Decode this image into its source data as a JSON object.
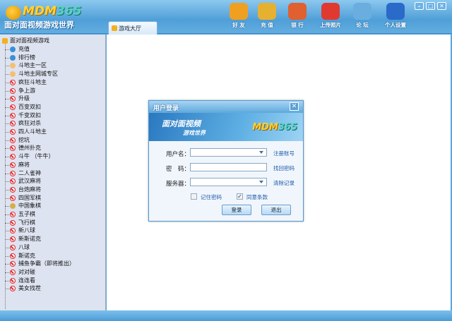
{
  "app": {
    "brand": "MDM",
    "brand_num": "365",
    "slogan": "面对面视频游戏世界"
  },
  "tab": {
    "label": "游戏大厅"
  },
  "toolbar": [
    {
      "label": "好 友",
      "icon": "friends-icon",
      "color": "#f0a020"
    },
    {
      "label": "充 值",
      "icon": "coins-icon",
      "color": "#e6b030"
    },
    {
      "label": "银 行",
      "icon": "bank-house-icon",
      "color": "#e06030"
    },
    {
      "label": "上传照片",
      "icon": "camera-icon",
      "color": "#e03a30"
    },
    {
      "label": "论 坛",
      "icon": "forum-bubble-icon",
      "color": "#6aaee0"
    },
    {
      "label": "个人设置",
      "icon": "user-settings-icon",
      "color": "#2a6ac8"
    }
  ],
  "window_controls": {
    "min": "–",
    "max": "□",
    "close": "✕"
  },
  "tree": {
    "root": "面对面视频游戏",
    "items": [
      {
        "label": "充值",
        "icon": "ie"
      },
      {
        "label": "排行榜",
        "icon": "ie"
      },
      {
        "label": "斗地主一区",
        "icon": "dz"
      },
      {
        "label": "斗地主网城专区",
        "icon": "dz"
      },
      {
        "label": "疯狂斗地主",
        "icon": "ban"
      },
      {
        "label": "争上游",
        "icon": "ban"
      },
      {
        "label": "升级",
        "icon": "ban"
      },
      {
        "label": "百变双扣",
        "icon": "ban"
      },
      {
        "label": "千变双扣",
        "icon": "ban"
      },
      {
        "label": "疯狂对杀",
        "icon": "ban"
      },
      {
        "label": "四人斗地主",
        "icon": "ban"
      },
      {
        "label": "挖坑",
        "icon": "ban"
      },
      {
        "label": "德州扑克",
        "icon": "ban"
      },
      {
        "label": "斗牛 （牛牛）",
        "icon": "ban"
      },
      {
        "label": "麻将",
        "icon": "ban"
      },
      {
        "label": "二人雀神",
        "icon": "ban"
      },
      {
        "label": "武汉麻将",
        "icon": "ban"
      },
      {
        "label": "台炮麻将",
        "icon": "ban"
      },
      {
        "label": "四国军棋",
        "icon": "ban"
      },
      {
        "label": "中国象棋",
        "icon": "cc"
      },
      {
        "label": "五子棋",
        "icon": "ban"
      },
      {
        "label": "飞行棋",
        "icon": "ban"
      },
      {
        "label": "新八球",
        "icon": "ban"
      },
      {
        "label": "新斯诺克",
        "icon": "ban"
      },
      {
        "label": "八球",
        "icon": "ban"
      },
      {
        "label": "斯诺克",
        "icon": "ban"
      },
      {
        "label": "捕鱼争霸（即将推出）",
        "icon": "ban"
      },
      {
        "label": "对对碰",
        "icon": "ban"
      },
      {
        "label": "连连看",
        "icon": "ban"
      },
      {
        "label": "美女找茬",
        "icon": "ban"
      }
    ]
  },
  "login": {
    "title": "用户登录",
    "close": "✕",
    "banner_line1": "面对面视频",
    "banner_line2": "游戏世界",
    "banner_brand": "MDM",
    "banner_num": "365",
    "username_label": "用户名：",
    "password_label": "密　码：",
    "server_label": "服务器：",
    "username_value": "",
    "password_value": "",
    "server_value": "",
    "register_link": "注册账号",
    "recover_link": "找回密码",
    "clear_link": "清除记录",
    "remember_label": "记住密码",
    "remember_checked": false,
    "agree_label": "同意条款",
    "agree_checked": true,
    "login_button": "登录",
    "exit_button": "退出"
  }
}
